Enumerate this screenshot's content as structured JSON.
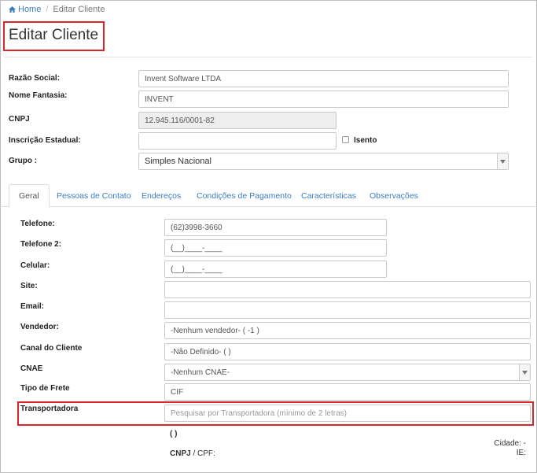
{
  "breadcrumb": {
    "home": "Home",
    "separator": "/",
    "current": "Editar Cliente"
  },
  "page": {
    "title": "Editar Cliente"
  },
  "form": {
    "razao_social": {
      "label": "Razão Social:",
      "value": "Invent Software LTDA"
    },
    "nome_fantasia": {
      "label": "Nome Fantasia:",
      "value": "INVENT"
    },
    "cnpj": {
      "label": "CNPJ",
      "value": "12.945.116/0001-82"
    },
    "inscricao_estadual": {
      "label": "Inscrição Estadual:",
      "value": "",
      "isento_label": "Isento"
    },
    "grupo": {
      "label": "Grupo :",
      "value": "Simples Nacional"
    }
  },
  "tabs": [
    {
      "label": "Geral"
    },
    {
      "label": "Pessoas de Contato"
    },
    {
      "label": "Endereços"
    },
    {
      "label": "Condições de Pagamento"
    },
    {
      "label": "Características"
    },
    {
      "label": "Observações"
    }
  ],
  "geral": {
    "telefone": {
      "label": "Telefone:",
      "value": "(62)3998-3660"
    },
    "telefone2": {
      "label": "Telefone 2:",
      "value": "(__)____-____"
    },
    "celular": {
      "label": "Celular:",
      "value": "(__)____-____"
    },
    "site": {
      "label": "Site:",
      "value": ""
    },
    "email": {
      "label": "Email:",
      "value": ""
    },
    "vendedor": {
      "label": "Vendedor:",
      "value": "-Nenhum vendedor- ( -1 )"
    },
    "canal": {
      "label": "Canal do Cliente",
      "value": "-Não Definido- ( )"
    },
    "cnae": {
      "label": "CNAE",
      "value": "-Nenhum CNAE-"
    },
    "frete": {
      "label": "Tipo de Frete",
      "value": "CIF"
    },
    "transportadora": {
      "label": "Transportadora",
      "placeholder": "Pesquisar por Transportadora (mínimo de 2 letras)"
    },
    "transp_info": {
      "parens": "( )",
      "cnpj_label": "CNPJ",
      "cnpj_suffix": "/ CPF:",
      "cidade": "Cidade: -",
      "ie": "IE:"
    }
  },
  "colors": {
    "link": "#3b7dbd",
    "highlight": "#d9262c"
  }
}
